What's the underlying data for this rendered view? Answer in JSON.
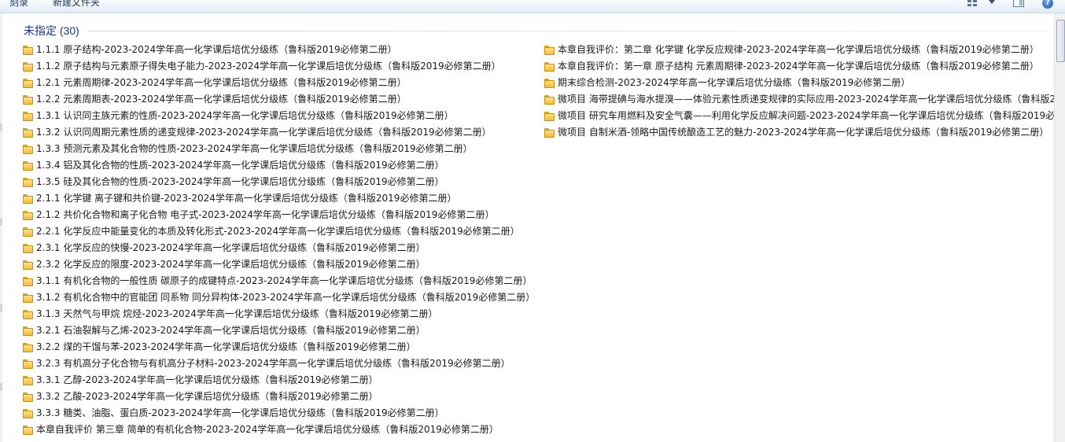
{
  "toolbar": {
    "burn_label": "刻录",
    "new_folder_label": "新建文件夹"
  },
  "group": {
    "title": "未指定 (30)"
  },
  "left_items": [
    "1.1.1 原子结构-2023-2024学年高一化学课后培优分级练（鲁科版2019必修第二册）",
    "1.1.2 原子结构与元素原子得失电子能力-2023-2024学年高一化学课后培优分级练（鲁科版2019必修第二册）",
    "1.2.1 元素周期律-2023-2024学年高一化学课后培优分级练（鲁科版2019必修第二册）",
    "1.2.2 元素周期表-2023-2024学年高一化学课后培优分级练（鲁科版2019必修第二册）",
    "1.3.1 认识同主族元素的性质-2023-2024学年高一化学课后培优分级练（鲁科版2019必修第二册）",
    "1.3.2 认识同周期元素性质的递变规律-2023-2024学年高一化学课后培优分级练（鲁科版2019必修第二册）",
    "1.3.3 预测元素及其化合物的性质-2023-2024学年高一化学课后培优分级练（鲁科版2019必修第二册）",
    "1.3.4 铝及其化合物的性质-2023-2024学年高一化学课后培优分级练（鲁科版2019必修第二册）",
    "1.3.5 硅及其化合物的性质-2023-2024学年高一化学课后培优分级练（鲁科版2019必修第二册）",
    "2.1.1 化学键 离子键和共价键-2023-2024学年高一化学课后培优分级练（鲁科版2019必修第二册）",
    "2.1.2 共价化合物和离子化合物 电子式-2023-2024学年高一化学课后培优分级练（鲁科版2019必修第二册）",
    "2.2.1 化学反应中能量变化的本质及转化形式-2023-2024学年高一化学课后培优分级练（鲁科版2019必修第二册）",
    "2.3.1 化学反应的快慢-2023-2024学年高一化学课后培优分级练（鲁科版2019必修第二册）",
    "2.3.2 化学反应的限度-2023-2024学年高一化学课后培优分级练（鲁科版2019必修第二册）",
    "3.1.1 有机化合物的一般性质 碳原子的成键特点-2023-2024学年高一化学课后培优分级练（鲁科版2019必修第二册）",
    "3.1.2 有机化合物中的官能团 同系物 同分异构体-2023-2024学年高一化学课后培优分级练（鲁科版2019必修第二册）",
    "3.1.3 天然气与甲烷 烷烃-2023-2024学年高一化学课后培优分级练（鲁科版2019必修第二册）",
    "3.2.1 石油裂解与乙烯-2023-2024学年高一化学课后培优分级练（鲁科版2019必修第二册）",
    "3.2.2 煤的干馏与苯-2023-2024学年高一化学课后培优分级练（鲁科版2019必修第二册）",
    "3.2.3 有机高分子化合物与有机高分子材料-2023-2024学年高一化学课后培优分级练（鲁科版2019必修第二册）",
    "3.3.1 乙醇-2023-2024学年高一化学课后培优分级练（鲁科版2019必修第二册）",
    "3.3.2 乙酸-2023-2024学年高一化学课后培优分级练（鲁科版2019必修第二册）",
    "3.3.3 糖类、油脂、蛋白质-2023-2024学年高一化学课后培优分级练（鲁科版2019必修第二册）",
    "本章自我评价 第三章 简单的有机化合物-2023-2024学年高一化学课后培优分级练（鲁科版2019必修第二册）"
  ],
  "right_items": [
    "本章自我评价：第二章 化学键 化学反应规律-2023-2024学年高一化学课后培优分级练（鲁科版2019必修第二册）",
    "本章自我评价：第一章 原子结构 元素周期律-2023-2024学年高一化学课后培优分级练（鲁科版2019必修第二册）",
    "期末综合检测-2023-2024学年高一化学课后培优分级练（鲁科版2019必修第二册）",
    "微项目 海带提碘与海水提溴——体验元素性质递变规律的实际应用-2023-2024学年高一化学课后培优分级练（鲁科版201",
    "微项目 研究车用燃料及安全气囊——利用化学反应解决问题-2023-2024学年高一化学课后培优分级练（鲁科版2019必修第",
    "微项目 自制米酒-领略中国传统酿造工艺的魅力-2023-2024学年高一化学课后培优分级练（鲁科版2019必修第二册）"
  ],
  "icons": {
    "folder": "folder-icon",
    "view": "view-options-icon",
    "dropdown": "chevron-down-icon",
    "preview": "preview-pane-icon",
    "help": "help-icon"
  },
  "colors": {
    "group_title": "#1e3287",
    "folder": "#f1bd3a"
  }
}
